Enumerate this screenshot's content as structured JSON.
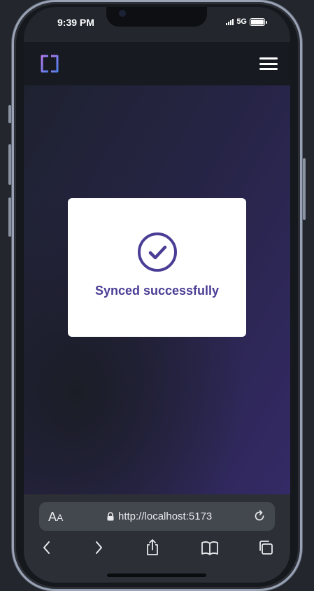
{
  "status_bar": {
    "time": "9:39 PM",
    "network": "5G"
  },
  "header": {
    "logo": "app-logo",
    "menu_icon": "hamburger-menu-icon"
  },
  "modal": {
    "icon": "check-circle-icon",
    "message": "Synced successfully"
  },
  "browser": {
    "text_size_label": "A",
    "text_size_label_small": "A",
    "url": "http://localhost:5173",
    "toolbar": [
      "back-icon",
      "forward-icon",
      "share-icon",
      "bookmarks-icon",
      "tabs-icon"
    ]
  },
  "colors": {
    "accent": "#4a3d95",
    "header_bg": "#171a20",
    "modal_bg": "#ffffff"
  }
}
